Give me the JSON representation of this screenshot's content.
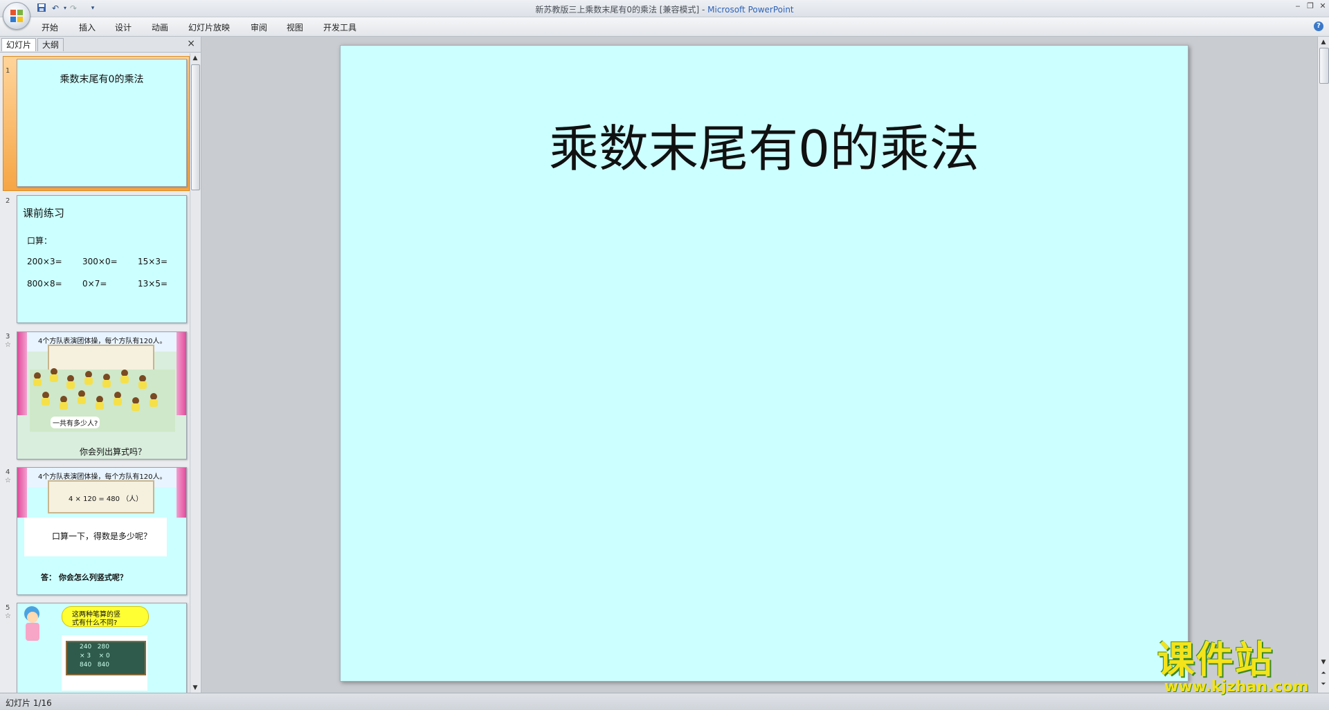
{
  "window": {
    "title": "新苏教版三上乘数末尾有0的乘法 [兼容模式] - ",
    "app_name": "Microsoft PowerPoint"
  },
  "quick_access": [
    "save-icon",
    "undo-icon",
    "redo-icon",
    "customize-icon"
  ],
  "ribbon": {
    "tabs": [
      "开始",
      "插入",
      "设计",
      "动画",
      "幻灯片放映",
      "审阅",
      "视图",
      "开发工具"
    ]
  },
  "pane": {
    "tab_slides": "幻灯片",
    "tab_outline": "大纲",
    "close": "×"
  },
  "slides": [
    {
      "num": "1",
      "title": "乘数末尾有0的乘法"
    },
    {
      "num": "2",
      "title": "课前练习",
      "subtitle": "口算：",
      "cells": [
        "200×3=",
        "300×0=",
        "15×3=",
        "800×8=",
        "0×7=",
        "13×5="
      ]
    },
    {
      "num": "3",
      "top_caption": "4个方队表演团体操，每个方队有120人。",
      "bubble": "一共有多少人?",
      "bottom": "你会列出算式吗？"
    },
    {
      "num": "4",
      "top_caption": "4个方队表演团体操，每个方队有120人。",
      "equation": "4  ×  120 =  480  （人）",
      "box": "口算一下，得数是多少呢？",
      "bottom": "答：    你会怎么列竖式呢？"
    },
    {
      "num": "5",
      "bubble_line1": "这两种笔算的竖",
      "bubble_line2": "式有什么不同?",
      "board": [
        "240   280",
        "× 3    × 0",
        "840   840"
      ]
    }
  ],
  "main_slide": {
    "title": "乘数末尾有0的乘法"
  },
  "status": {
    "text": "幻灯片 1/16"
  },
  "watermark": {
    "big": "课件站",
    "url": "www.kjzhan.com"
  }
}
